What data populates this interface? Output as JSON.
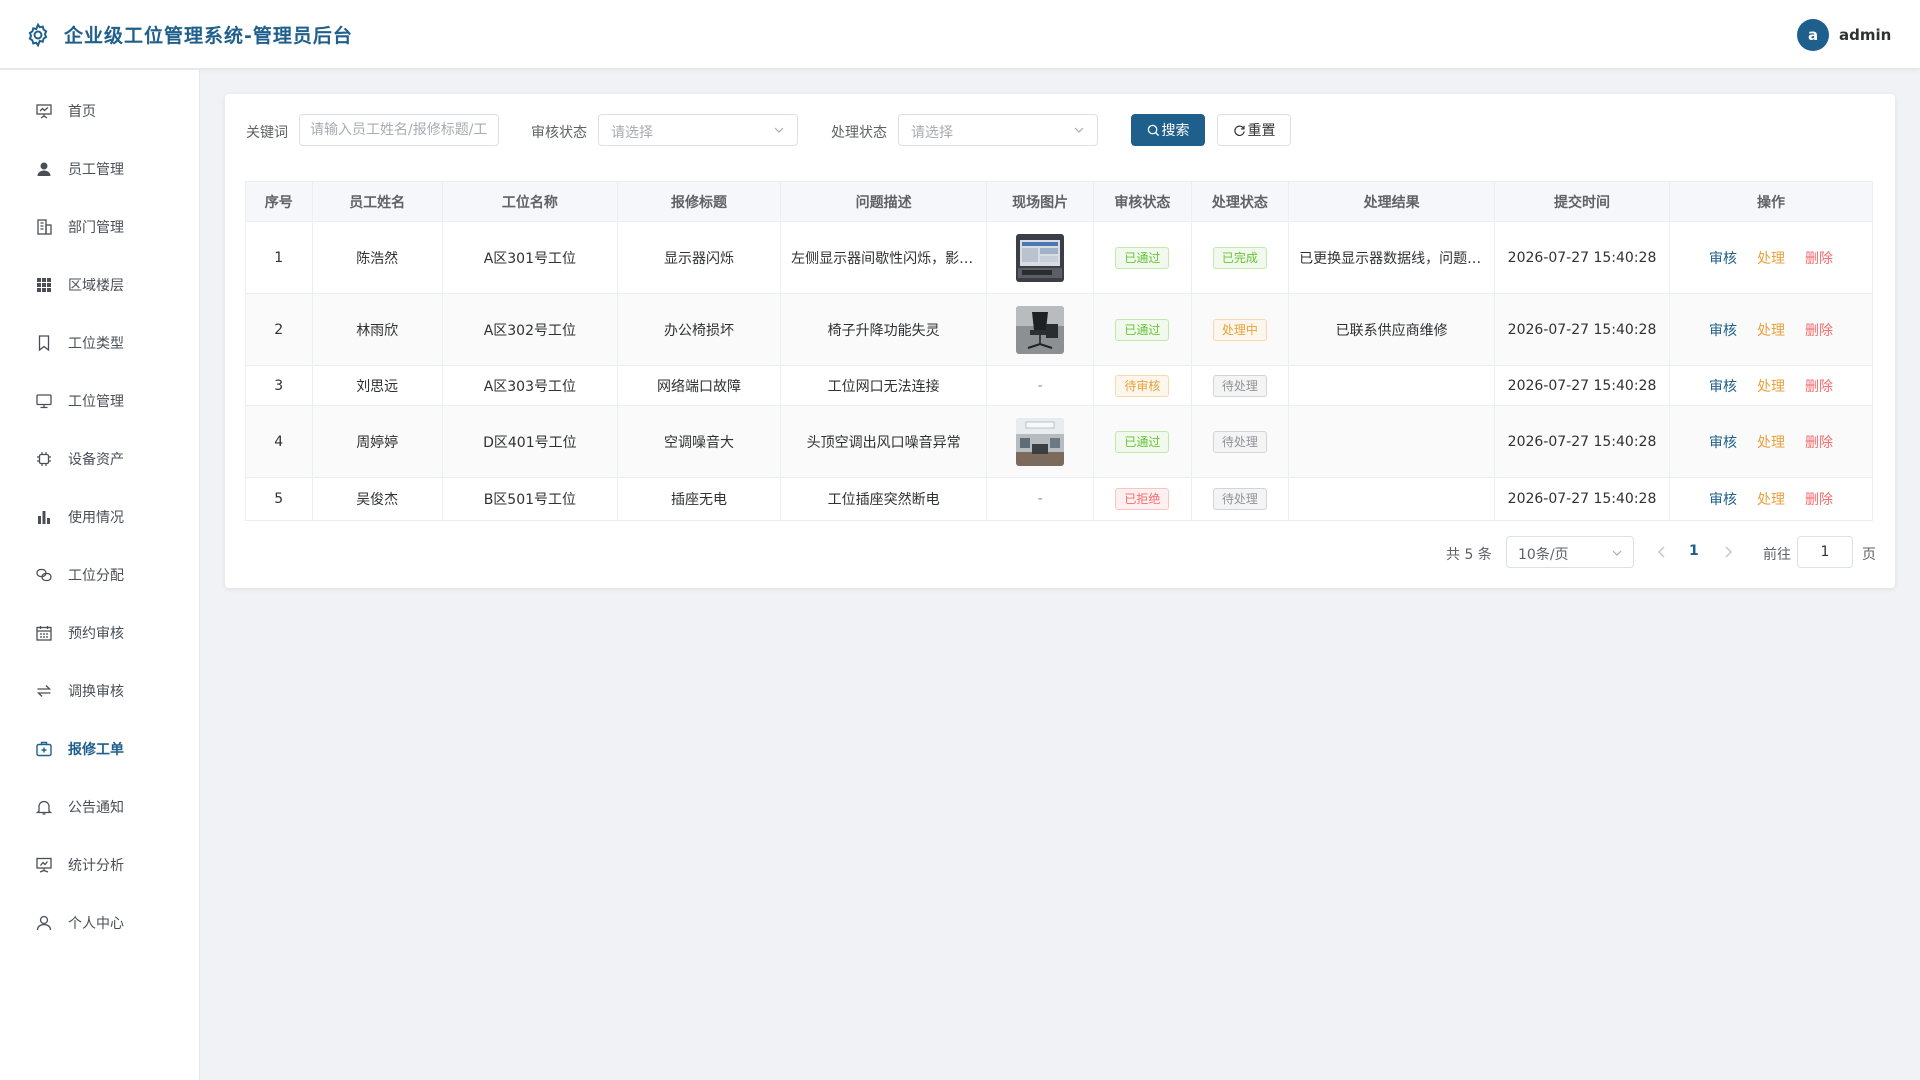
{
  "header": {
    "title": "企业级工位管理系统-管理员后台",
    "user_initial": "a",
    "username": "admin"
  },
  "sidebar": {
    "items": [
      {
        "label": "首页",
        "icon": "presentation-icon"
      },
      {
        "label": "员工管理",
        "icon": "user-icon"
      },
      {
        "label": "部门管理",
        "icon": "building-icon"
      },
      {
        "label": "区域楼层",
        "icon": "grid-icon"
      },
      {
        "label": "工位类型",
        "icon": "bookmark-icon"
      },
      {
        "label": "工位管理",
        "icon": "monitor-icon"
      },
      {
        "label": "设备资产",
        "icon": "chip-icon"
      },
      {
        "label": "使用情况",
        "icon": "bar-chart-icon"
      },
      {
        "label": "工位分配",
        "icon": "connection-icon"
      },
      {
        "label": "预约审核",
        "icon": "calendar-icon"
      },
      {
        "label": "调换审核",
        "icon": "switch-icon"
      },
      {
        "label": "报修工单",
        "icon": "first-aid-kit-icon",
        "active": true
      },
      {
        "label": "公告通知",
        "icon": "bell-icon"
      },
      {
        "label": "统计分析",
        "icon": "data-board-icon"
      },
      {
        "label": "个人中心",
        "icon": "user-outline-icon"
      }
    ]
  },
  "filters": {
    "keyword_label": "关键词",
    "keyword_placeholder": "请输入员工姓名/报修标题/工位名称",
    "audit_label": "审核状态",
    "audit_placeholder": "请选择",
    "process_label": "处理状态",
    "process_placeholder": "请选择",
    "search_button": "搜索",
    "reset_button": "重置"
  },
  "table": {
    "columns": [
      "序号",
      "员工姓名",
      "工位名称",
      "报修标题",
      "问题描述",
      "现场图片",
      "审核状态",
      "处理状态",
      "处理结果",
      "提交时间",
      "操作"
    ],
    "actions": {
      "audit": "审核",
      "process": "处理",
      "delete": "删除"
    },
    "empty_placeholder": "-",
    "rows": [
      {
        "no": "1",
        "name": "陈浩然",
        "station": "A区301号工位",
        "title": "显示器闪烁",
        "desc": "左侧显示器间歇性闪烁，影响正常办公",
        "image": "monitor-photo",
        "audit": "已通过",
        "audit_type": "success",
        "process": "已完成",
        "process_type": "success",
        "result": "已更换显示器数据线，问题已解决",
        "time": "2026-07-27 15:40:28"
      },
      {
        "no": "2",
        "name": "林雨欣",
        "station": "A区302号工位",
        "title": "办公椅损坏",
        "desc": "椅子升降功能失灵",
        "image": "chair-photo",
        "audit": "已通过",
        "audit_type": "success",
        "process": "处理中",
        "process_type": "warning",
        "result": "已联系供应商维修",
        "time": "2026-07-27 15:40:28"
      },
      {
        "no": "3",
        "name": "刘思远",
        "station": "A区303号工位",
        "title": "网络端口故障",
        "desc": "工位网口无法连接",
        "image": "",
        "audit": "待审核",
        "audit_type": "warning",
        "process": "待处理",
        "process_type": "info",
        "result": "",
        "time": "2026-07-27 15:40:28"
      },
      {
        "no": "4",
        "name": "周婷婷",
        "station": "D区401号工位",
        "title": "空调噪音大",
        "desc": "头顶空调出风口噪音异常",
        "image": "office-photo",
        "audit": "已通过",
        "audit_type": "success",
        "process": "待处理",
        "process_type": "info",
        "result": "",
        "time": "2026-07-27 15:40:28"
      },
      {
        "no": "5",
        "name": "吴俊杰",
        "station": "B区501号工位",
        "title": "插座无电",
        "desc": "工位插座突然断电",
        "image": "",
        "audit": "已拒绝",
        "audit_type": "danger",
        "process": "待处理",
        "process_type": "info",
        "result": "",
        "time": "2026-07-27 15:40:28"
      }
    ]
  },
  "pagination": {
    "total_text": "共 5 条",
    "page_size": "10条/页",
    "current_page": "1",
    "goto_label": "前往",
    "goto_value": "1",
    "page_suffix": "页"
  },
  "colors": {
    "primary": "#1f5f8b",
    "success": "#67c23a",
    "warning": "#e6a23c",
    "danger": "#f56c6c",
    "info": "#909399"
  }
}
